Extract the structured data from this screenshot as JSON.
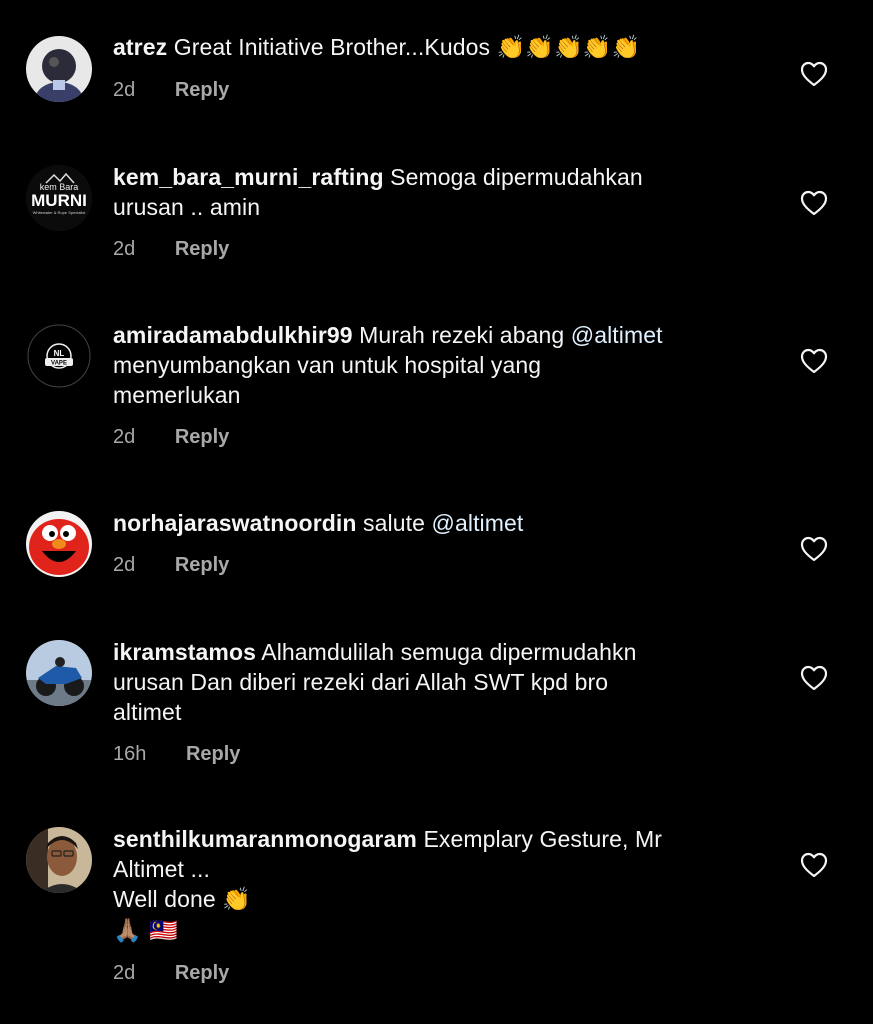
{
  "comments": [
    {
      "username": "atrez",
      "text_parts": [
        "Great Initiative Brother...Kudos ",
        "👏👏👏👏👏"
      ],
      "age": "2d",
      "reply_label": "Reply"
    },
    {
      "username": "kem_bara_murni_rafting",
      "text_parts": [
        "Semoga dipermudahkan",
        "urusan .. amin"
      ],
      "age": "2d",
      "reply_label": "Reply",
      "avatar_text": {
        "line1": "kem Bara",
        "line2": "MURNI",
        "line3": "Whitewater & Rope Specialist"
      }
    },
    {
      "username": "amiradamabdulkhir99",
      "text_parts": [
        "Murah rezeki abang ",
        "@altimet",
        "menyumbangkan van untuk hospital yang",
        "memerlukan"
      ],
      "age": "2d",
      "reply_label": "Reply",
      "avatar_text": {
        "line1": "NL",
        "line2": "VAPE"
      }
    },
    {
      "username": "norhajaraswatnoordin",
      "text_parts": [
        "salute ",
        "@altimet"
      ],
      "age": "2d",
      "reply_label": "Reply"
    },
    {
      "username": "ikramstamos",
      "text_parts": [
        "Alhamdulilah semuga dipermudahkn",
        "urusan Dan diberi rezeki dari Allah SWT kpd bro",
        "altimet"
      ],
      "age": "16h",
      "reply_label": "Reply"
    },
    {
      "username": "senthilkumaranmonogaram",
      "text_parts": [
        "Exemplary Gesture, Mr",
        "Altimet ...",
        "Well done ",
        "👏",
        "🙏🏽 🇲🇾"
      ],
      "age": "2d",
      "reply_label": "Reply"
    }
  ],
  "colors": {
    "background": "#000000",
    "text": "#f5f5f5",
    "muted": "#a8a8a8"
  },
  "icons": {
    "like": "heart-outline-icon"
  }
}
